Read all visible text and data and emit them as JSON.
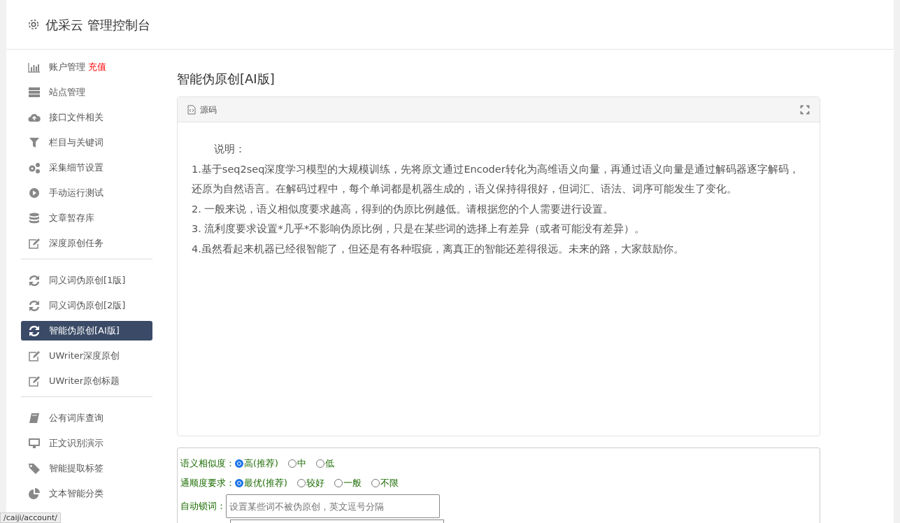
{
  "header": {
    "title": "优采云 管理控制台"
  },
  "sidebar": {
    "groups": [
      {
        "items": [
          {
            "label": "账户管理",
            "tag": "充值",
            "selected": false
          },
          {
            "label": "站点管理",
            "selected": false
          },
          {
            "label": "接口文件相关",
            "selected": false
          },
          {
            "label": "栏目与关键词",
            "selected": false
          },
          {
            "label": "采集细节设置",
            "selected": false
          },
          {
            "label": "手动运行测试",
            "selected": false
          },
          {
            "label": "文章暂存库",
            "selected": false
          },
          {
            "label": "深度原创任务",
            "selected": false
          }
        ]
      },
      {
        "items": [
          {
            "label": "同义词伪原创[1版]",
            "selected": false
          },
          {
            "label": "同义词伪原创[2版]",
            "selected": false
          },
          {
            "label": "智能伪原创[AI版]",
            "selected": true
          },
          {
            "label": "UWriter深度原创",
            "selected": false
          },
          {
            "label": "UWriter原创标题",
            "selected": false
          }
        ]
      },
      {
        "items": [
          {
            "label": "公有词库查询",
            "selected": false
          },
          {
            "label": "正文识别演示",
            "selected": false
          },
          {
            "label": "智能提取标签",
            "selected": false
          },
          {
            "label": "文本智能分类",
            "selected": false
          }
        ]
      }
    ]
  },
  "page_title": "智能伪原创[AI版]",
  "source_panel": {
    "title": "源码",
    "text": [
      "说明：",
      "1.基于seq2seq深度学习模型的大规模训练，先将原文通过Encoder转化为高维语义向量，再通过语义向量是通过解码器逐字解码，还原为自然语言。在解码过程中，每个单词都是机器生成的，语义保持得很好，但词汇、语法、词序可能发生了变化。",
      "2. 一般来说，语义相似度要求越高，得到的伪原比例越低。请根据您的个人需要进行设置。",
      "3. 流利度要求设置*几乎*不影响伪原比例，只是在某些词的选择上有差异（或者可能没有差异）。",
      "4.虽然看起来机器已经很智能了，但还是有各种瑕疵，离真正的智能还差得很远。未来的路，大家鼓励你。"
    ]
  },
  "options": {
    "radio_groups": [
      {
        "label": "语义相似度：",
        "options": [
          {
            "label": "高(推荐)",
            "selected": true
          },
          {
            "label": "中",
            "selected": false
          },
          {
            "label": "低",
            "selected": false
          }
        ]
      },
      {
        "label": "通顺度要求：",
        "options": [
          {
            "label": "最优(推荐)",
            "selected": true
          },
          {
            "label": "较好",
            "selected": false
          },
          {
            "label": "一般",
            "selected": false
          },
          {
            "label": "不限",
            "selected": false
          }
        ]
      }
    ],
    "lock_words": {
      "label": "自动锁词：",
      "placeholder": "设置某些词不被伪原创，英文逗号分隔"
    }
  },
  "status_bar": {
    "url": "/caiji/account/"
  }
}
